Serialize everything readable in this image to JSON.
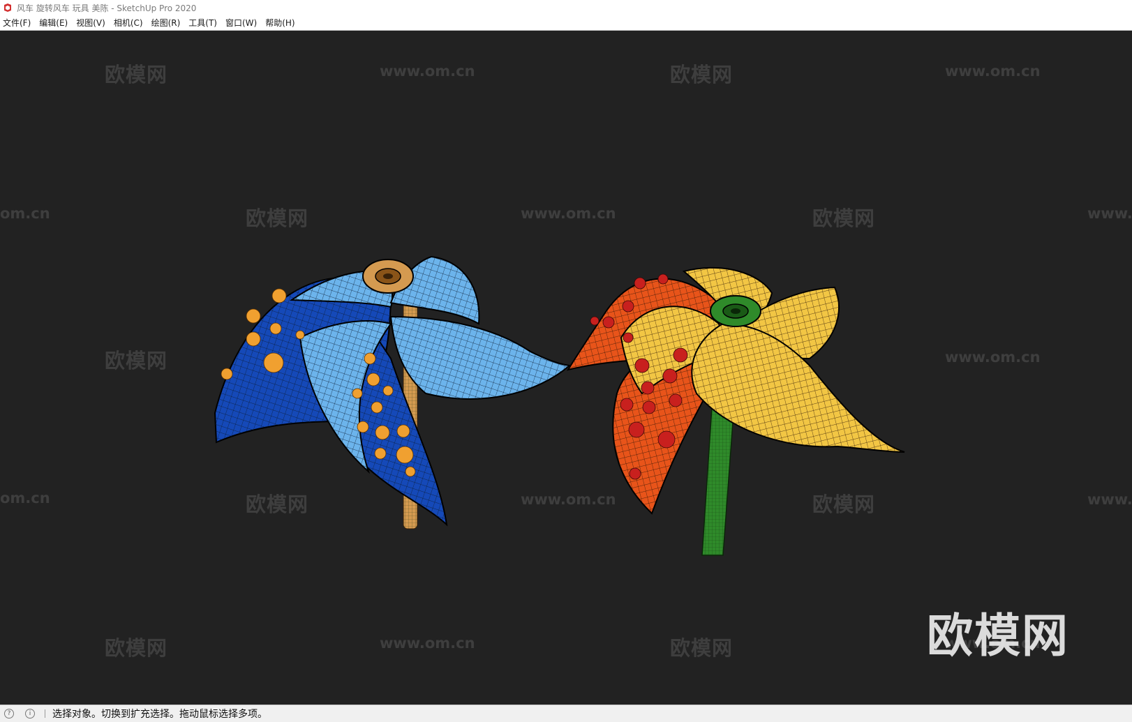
{
  "window": {
    "title": "风车 旋转风车 玩具 美陈 - SketchUp Pro 2020"
  },
  "menu": {
    "items": [
      "文件(F)",
      "编辑(E)",
      "视图(V)",
      "相机(C)",
      "绘图(R)",
      "工具(T)",
      "窗口(W)",
      "帮助(H)"
    ]
  },
  "watermark": {
    "brand": "欧模网",
    "url": "www.om.cn",
    "url_partial_right": "www.",
    "url_partial_left": "om.cn"
  },
  "status": {
    "text": "选择对象。切换到扩充选择。拖动鼠标选择多项。"
  },
  "colors": {
    "viewport_bg": "#222222",
    "blue_pinwheel_light": "#6cb4ec",
    "blue_pinwheel_dark": "#1549b8",
    "dot_orange": "#f0a030",
    "orange_pinwheel": "#e8541a",
    "yellow_pinwheel": "#f2c644",
    "dot_red": "#c8201e",
    "stick_green": "#2f8a2a",
    "stick_tan": "#d49a50"
  },
  "icons": {
    "app": "sketchup-icon",
    "status_1": "geo-location-icon",
    "status_2": "info-icon"
  }
}
